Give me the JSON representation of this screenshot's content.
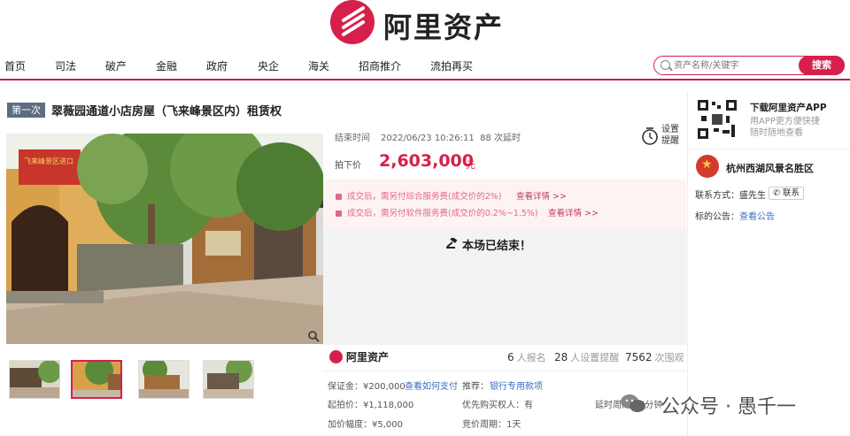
{
  "header": {
    "logo_text": "阿里资产",
    "nav": [
      "首页",
      "司法",
      "破产",
      "金融",
      "政府",
      "央企",
      "海关",
      "招商推介",
      "流拍再买"
    ],
    "search_placeholder": "资产名称/关键字",
    "search_button": "搜索"
  },
  "listing": {
    "round": "第一次",
    "title": "翠薇园通道小店房屋（飞来峰景区内）租赁权",
    "end_time_label": "结束时间",
    "end_time_value": "2022/06/23 10:26:11",
    "delay_count": "88",
    "delay_label": "次延时",
    "final_price_label": "拍下价",
    "final_price": "2,603,000",
    "price_unit": "元",
    "remind_label_1": "设置",
    "remind_label_2": "提醒",
    "fee_1": "成交后，需另付综合服务费(成交价的2%)",
    "fee_2": "成交后，需另付软件服务费(成交价的0.2%~1.5%)",
    "fee_link": "查看详情 >>",
    "ended": "本场已结束！",
    "photo_sign": "飞来峰景区进口"
  },
  "stats": {
    "brand": "阿里资产",
    "signup_count": "6",
    "signup_label": "人报名",
    "remind_count": "28",
    "remind_label": "人设置提醒",
    "views_count": "7562",
    "views_label": "次围观"
  },
  "details": {
    "deposit_label": "保证金：",
    "deposit_value": "¥200,000",
    "deposit_link": "查看如何支付",
    "recommend_label": "推荐：",
    "recommend_link": "银行专用款项",
    "start_label": "起拍价：",
    "start_value": "¥1,118,000",
    "priority_label": "优先购买权人",
    "priority_value": "：有",
    "delay_label": "延时周期：",
    "delay_value": "5分钟",
    "increment_label": "加价幅度：",
    "increment_value": "¥5,000",
    "cycle_label": "竞价周期：",
    "cycle_value": "1天"
  },
  "side": {
    "app_title": "下载阿里资产APP",
    "app_desc_1": "用APP更方便快捷",
    "app_desc_2": "随时随地查看",
    "org": "杭州西湖风景名胜区",
    "contact_label": "联系方式：",
    "contact_name": "盛先生",
    "contact_button": "联系",
    "notice_label": "标的公告：",
    "notice_link": "查看公告"
  },
  "watermark": "公众号 · 愚千一",
  "colors": {
    "brand": "#d6204b",
    "link": "#3b6dc6",
    "fee": "#e06a80"
  }
}
